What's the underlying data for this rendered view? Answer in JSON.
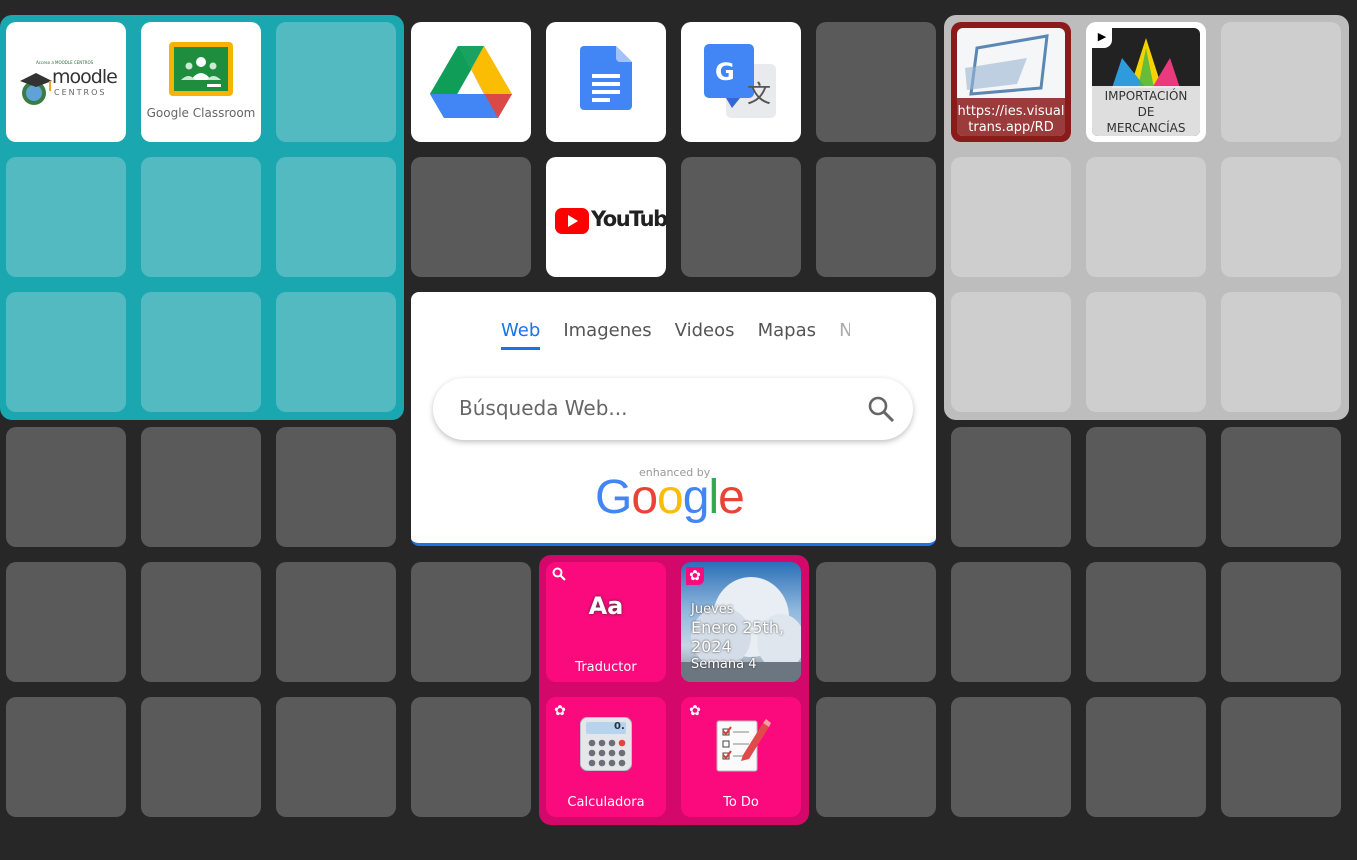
{
  "shortcuts": {
    "moodle": {
      "small_text": "Acceso a MOODLE CENTROS",
      "name": "moodle",
      "sub": "CENTROS"
    },
    "classroom": {
      "label": "Google Classroom"
    },
    "youtube": {
      "label": "YouTube"
    },
    "translate": {
      "letter": "G",
      "glyph": "文"
    },
    "visualtrans": {
      "label": "https://ies.visualtrans.app/RD",
      "line1": "https://ies.visual",
      "line2": "trans.app/RD"
    },
    "importacion": {
      "line1": "IMPORTACIÓN",
      "line2": "DE",
      "line3": "MERCANCÍAS"
    }
  },
  "search": {
    "tabs": [
      "Web",
      "Imagenes",
      "Videos",
      "Mapas",
      "No"
    ],
    "active_tab": "Web",
    "placeholder": "Búsqueda Web...",
    "enhanced_by": "enhanced by",
    "google": "Google"
  },
  "widgets": {
    "traductor": {
      "label": "Traductor",
      "icon_text": "Aa"
    },
    "date": {
      "weekday": "Jueves",
      "date_line1": "Enero 25th,",
      "date_line2": "2024",
      "week": "Semana 4"
    },
    "calculadora": {
      "label": "Calculadora",
      "display": "0."
    },
    "todo": {
      "label": "To Do"
    }
  },
  "colors": {
    "background": "#272727",
    "teal_group": "#1aa7b0",
    "grey_group": "#bdbdbd",
    "pink_group": "#d4086a",
    "pink_tile": "#fb0a7e",
    "accent": "#1a73e8"
  }
}
